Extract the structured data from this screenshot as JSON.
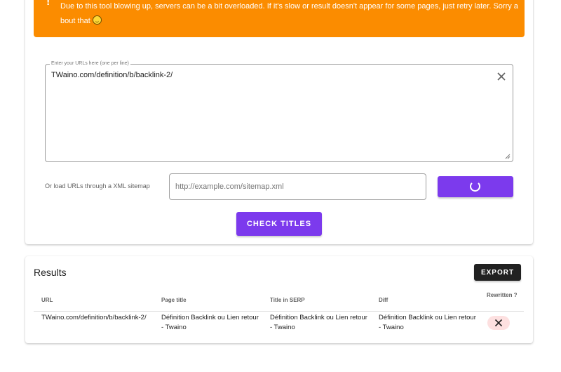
{
  "alert": {
    "icon": "!",
    "message": "Due to this tool blowing up, servers can be a bit overloaded. If it's slow or result doesn't appear for some pages, just retry later. Sorry about that",
    "emoji": "smiling-face-emoji"
  },
  "url_input": {
    "legend": "Enter your URLs here (one per line)",
    "value": "TWaino.com/definition/b/backlink-2/",
    "clear_icon": "close-icon"
  },
  "sitemap": {
    "label": "Or load URLs through a XML sitemap",
    "placeholder": "http://example.com/sitemap.xml",
    "load_button_icon": "loading-spinner-icon"
  },
  "check_button_label": "CHECK TITLES",
  "results": {
    "title": "Results",
    "export_label": "EXPORT",
    "columns": [
      "URL",
      "Page title",
      "Title in SERP",
      "Diff",
      "Rewritten ?"
    ],
    "rows": [
      {
        "url": "TWaino.com/definition/b/backlink-2/",
        "page_title": "Définition Backlink ou Lien retour - Twaino",
        "serp_title": "Définition Backlink ou Lien retour - Twaino",
        "diff": "Définition Backlink ou Lien retour - Twaino",
        "rewritten_icon": "close-icon"
      }
    ]
  },
  "colors": {
    "alert": "#fb8c00",
    "primary": "#7c3aed",
    "export": "#212121",
    "reject_chip": "#fde0e0"
  }
}
